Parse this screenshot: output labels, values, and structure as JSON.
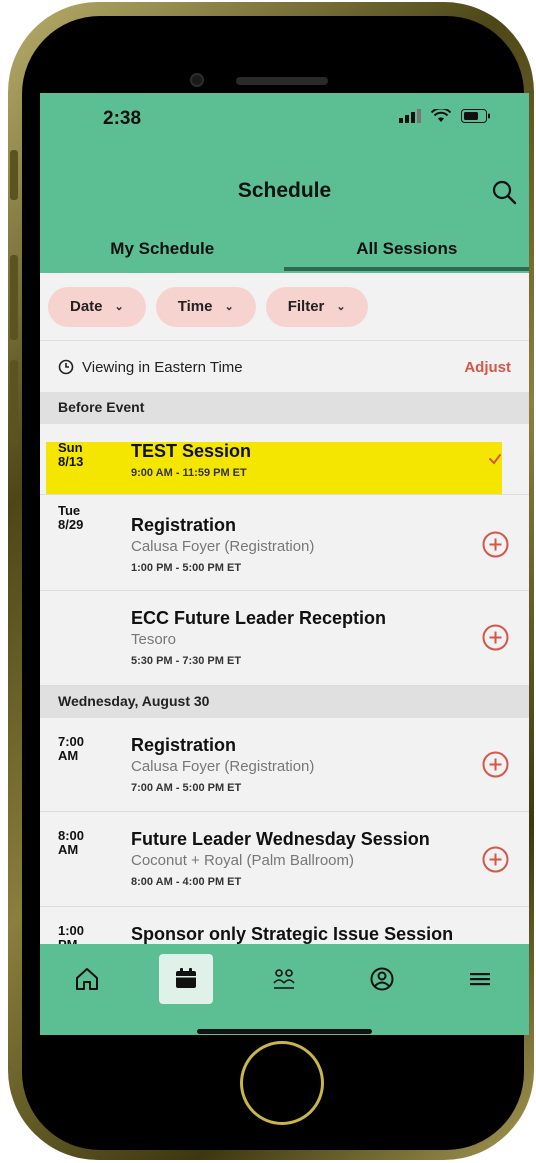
{
  "status_bar": {
    "time": "2:38"
  },
  "header": {
    "title": "Schedule",
    "tabs": [
      "My Schedule",
      "All Sessions"
    ],
    "active_tab": "All Sessions"
  },
  "filters": [
    {
      "label": "Date"
    },
    {
      "label": "Time"
    },
    {
      "label": "Filter"
    }
  ],
  "timezone": {
    "text": "Viewing in Eastern Time",
    "adjust_label": "Adjust"
  },
  "sections": [
    {
      "label": "Before Event"
    },
    {
      "label": "Wednesday, August 30"
    }
  ],
  "sessions": [
    {
      "day": "Sun",
      "date": "8/13",
      "title": "TEST Session",
      "location": "",
      "time": "9:00 AM - 11:59 PM ET",
      "added": true
    },
    {
      "day": "Tue",
      "date": "8/29",
      "title": "Registration",
      "location": "Calusa Foyer (Registration)",
      "time": "1:00 PM - 5:00 PM ET",
      "added": false
    },
    {
      "day": "",
      "date": "",
      "title": "ECC Future Leader Reception",
      "location": "Tesoro",
      "time": "5:30 PM - 7:30 PM ET",
      "added": false
    },
    {
      "day": "7:00",
      "date": "AM",
      "title": "Registration",
      "location": "Calusa Foyer (Registration)",
      "time": "7:00 AM - 5:00 PM ET",
      "added": false
    },
    {
      "day": "8:00",
      "date": "AM",
      "title": "Future Leader Wednesday Session",
      "location": "Coconut + Royal (Palm Ballroom)",
      "time": "8:00 AM - 4:00 PM ET",
      "added": false
    },
    {
      "day": "1:00",
      "date": "PM",
      "title": "Sponsor only Strategic Issue Session",
      "location": "",
      "time": "",
      "added": false
    }
  ],
  "bottom_nav": [
    {
      "icon": "home-icon"
    },
    {
      "icon": "calendar-icon",
      "active": true
    },
    {
      "icon": "people-icon"
    },
    {
      "icon": "profile-icon"
    },
    {
      "icon": "menu-icon"
    }
  ],
  "colors": {
    "header_green": "#5bbf93",
    "accent_red": "#d4574a",
    "chip_pink": "#f6d3ce",
    "highlight_yellow": "#f5e600"
  }
}
